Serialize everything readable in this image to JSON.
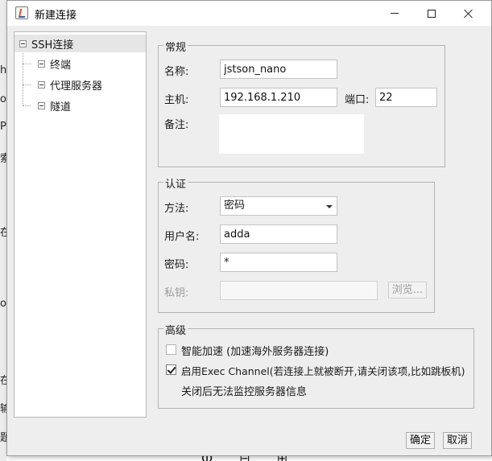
{
  "background_fragments": [
    "h",
    "o",
    "P",
    "索",
    "在",
    "ow",
    "在",
    "输",
    "题"
  ],
  "background_bottom_glyphs": "ⵀ ⊟ ⊞",
  "dialog": {
    "title": "新建连接",
    "window_buttons": {
      "minimize": "minimize-icon",
      "maximize": "maximize-icon",
      "close": "close-icon"
    }
  },
  "tree": {
    "root": "SSH连接",
    "children": [
      "终端",
      "代理服务器",
      "隧道"
    ]
  },
  "general": {
    "title": "常规",
    "name_label": "名称:",
    "name_value": "jstson_nano",
    "host_label": "主机:",
    "host_value": "192.168.1.210",
    "port_label": "端口:",
    "port_value": "22",
    "note_label": "备注:",
    "note_value": ""
  },
  "auth": {
    "title": "认证",
    "method_label": "方法:",
    "method_value": "密码",
    "user_label": "用户名:",
    "user_value": "adda",
    "password_label": "密码:",
    "password_value": "*",
    "key_label": "私钥:",
    "key_value": "",
    "browse_label": "浏览..."
  },
  "advanced": {
    "title": "高级",
    "smart_accel_label": "智能加速 (加速海外服务器连接)",
    "smart_accel_checked": false,
    "exec_channel_label": "启用Exec Channel(若连接上就被断开,请关闭该项,比如跳板机)",
    "exec_channel_checked": true,
    "exec_channel_note": "关闭后无法监控服务器信息"
  },
  "footer": {
    "ok_label": "确定",
    "cancel_label": "取消"
  }
}
